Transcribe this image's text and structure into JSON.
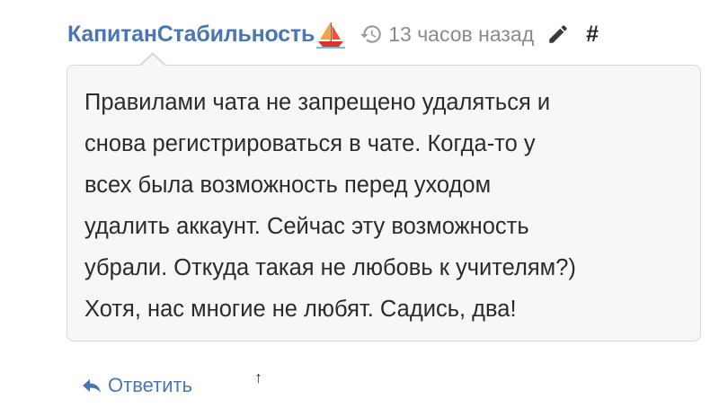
{
  "post": {
    "author": "КапитанСтабильность",
    "author_badge_icon": "sailboat-icon",
    "time_icon": "history-icon",
    "time_ago": "13 часов назад",
    "edit_icon": "pencil-icon",
    "permalink_label": "#",
    "message_lines": [
      "Правилами чата не запрещено удаляться и",
      "снова регистрироваться в чате. Когда-то у",
      "всех была возможность перед уходом",
      "удалить аккаунт. Сейчас эту возможность",
      "убрали. Откуда такая не любовь к учителям?)",
      "Хотя, нас многие не любят. Садись, два!"
    ]
  },
  "actions": {
    "reply_icon": "reply-arrow-icon",
    "reply_label": "Ответить",
    "up_label": "↑"
  },
  "colors": {
    "link": "#4a77b4",
    "muted": "#8a8a8a",
    "bubble_bg": "#f7f7f7",
    "bubble_border": "#d9d9d9",
    "text": "#2b2b2b"
  }
}
